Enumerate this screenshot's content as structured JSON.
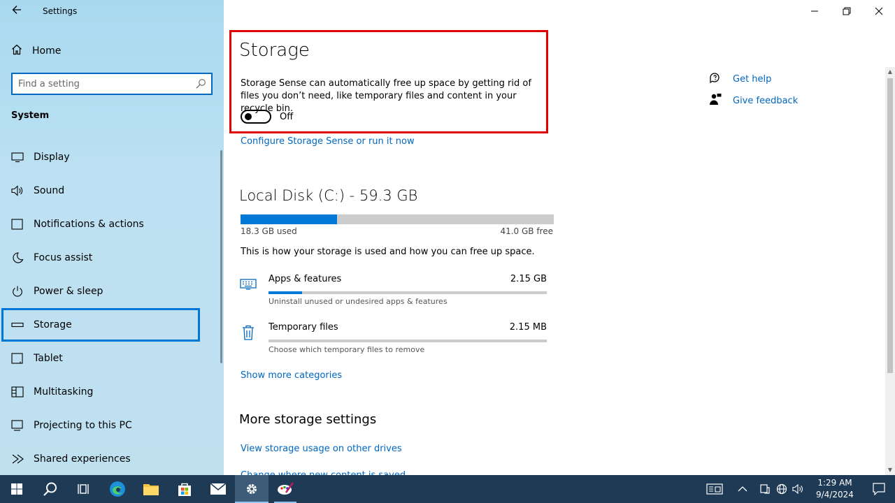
{
  "window": {
    "title": "Settings"
  },
  "sidebar": {
    "home_label": "Home",
    "search_placeholder": "Find a setting",
    "section_title": "System",
    "items": [
      {
        "label": "Display",
        "icon": "monitor-icon"
      },
      {
        "label": "Sound",
        "icon": "speaker-icon"
      },
      {
        "label": "Notifications & actions",
        "icon": "notification-icon"
      },
      {
        "label": "Focus assist",
        "icon": "moon-icon"
      },
      {
        "label": "Power & sleep",
        "icon": "power-icon"
      },
      {
        "label": "Storage",
        "icon": "drive-icon",
        "selected": true
      },
      {
        "label": "Tablet",
        "icon": "tablet-icon"
      },
      {
        "label": "Multitasking",
        "icon": "multitasking-icon"
      },
      {
        "label": "Projecting to this PC",
        "icon": "projector-icon"
      },
      {
        "label": "Shared experiences",
        "icon": "share-icon"
      }
    ]
  },
  "main": {
    "title": "Storage",
    "description": "Storage Sense can automatically free up space by getting rid of files you don’t need, like temporary files and content in your recycle bin.",
    "toggle_label": "Off",
    "configure_link": "Configure Storage Sense or run it now",
    "disk_title": "Local Disk (C:) - 59.3 GB",
    "used_label": "18.3 GB used",
    "free_label": "41.0 GB free",
    "used_fraction": 0.309,
    "info_text": "This is how your storage is used and how you can free up space.",
    "categories": [
      {
        "name": "Apps & features",
        "size": "2.15 GB",
        "sub": "Uninstall unused or undesired apps & features",
        "fraction": 0.12
      },
      {
        "name": "Temporary files",
        "size": "2.15 MB",
        "sub": "Choose which temporary files to remove",
        "fraction": 0.0
      }
    ],
    "show_more": "Show more categories",
    "more_settings_title": "More storage settings",
    "view_usage_link": "View storage usage on other drives",
    "cut_link": "Change where new content is saved"
  },
  "help": {
    "get_help": "Get help",
    "give_feedback": "Give feedback"
  },
  "taskbar": {
    "time": "1:29 AM",
    "date": "9/4/2024"
  },
  "colors": {
    "accent": "#0078d7",
    "link": "#0067c0",
    "highlight": "#e00000",
    "taskbar": "#1f3a55"
  }
}
